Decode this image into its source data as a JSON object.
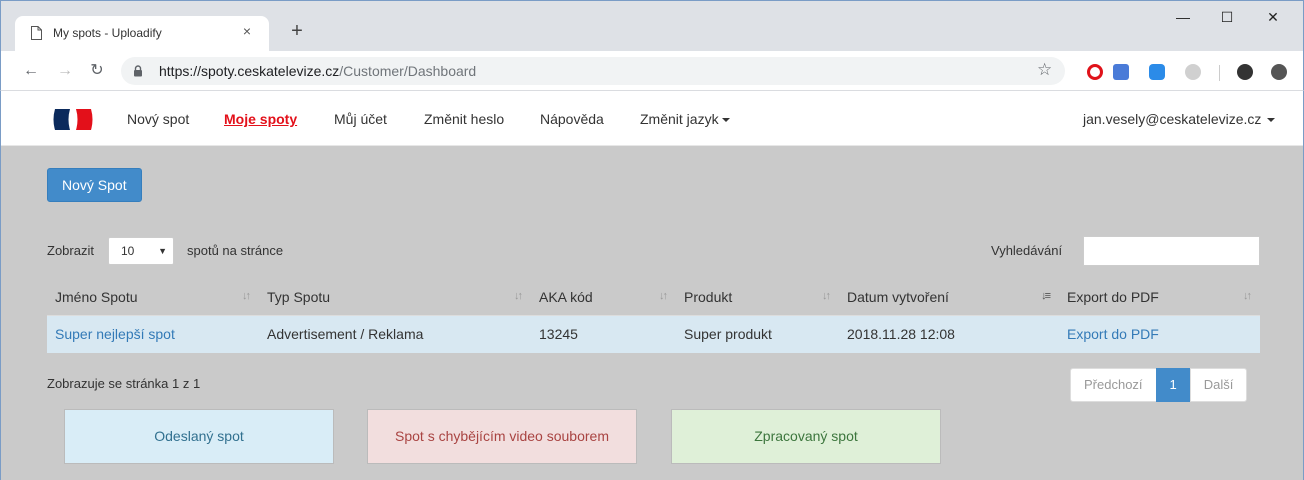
{
  "browser": {
    "tab_title": "My spots - Uploadify",
    "tab_close": "×",
    "new_tab": "+",
    "window_controls": {
      "minimize": "—",
      "maximize": "☐",
      "close": "✕"
    },
    "url_host": "https://spoty.ceskatelevize.cz",
    "url_path": "/Customer/Dashboard",
    "icons": [
      "page-icon",
      "back-icon",
      "forward-icon",
      "reload-icon",
      "lock-icon",
      "star-icon",
      "opera-icon",
      "translate-icon",
      "cloud-icon",
      "gray-extension-icon",
      "profile-icon",
      "update-icon"
    ]
  },
  "navbar": {
    "logo": "ceske-televize-logo",
    "links": [
      "Nový spot",
      "Moje spoty",
      "Můj účet",
      "Změnit heslo",
      "Nápověda",
      "Změnit jazyk"
    ],
    "active_index": 1,
    "user": "jan.vesely@ceskatelevize.cz"
  },
  "new_spot_button": "Nový Spot",
  "length": {
    "prefix": "Zobrazit",
    "value": "10",
    "suffix": "spotů na stránce"
  },
  "search": {
    "label": "Vyhledávání",
    "value": ""
  },
  "table": {
    "columns": [
      "Jméno Spotu",
      "Typ Spotu",
      "AKA kód",
      "Produkt",
      "Datum vytvoření",
      "Export do PDF"
    ],
    "sorted_column": 4,
    "rows": [
      [
        "Super nejlepší spot",
        "Advertisement / Reklama",
        "13245",
        "Super produkt",
        "2018.11.28 12:08",
        "Export do PDF"
      ]
    ]
  },
  "info": "Zobrazuje se stránka 1 z 1",
  "pagination": {
    "prev": "Předchozí",
    "current": "1",
    "next": "Další"
  },
  "legend": [
    {
      "label": "Odeslaný spot",
      "bg": "#d9edf7",
      "color": "#31708f"
    },
    {
      "label": "Spot s chybějícím video souborem",
      "bg": "#f2dede",
      "color": "#a94442"
    },
    {
      "label": "Zpracovaný spot",
      "bg": "#dff0d8",
      "color": "#3c763d"
    }
  ],
  "colors": {
    "primary": "#428bca",
    "active_link": "#e3101a",
    "link": "#337ab7",
    "row_highlight": "#d8e8f2"
  }
}
